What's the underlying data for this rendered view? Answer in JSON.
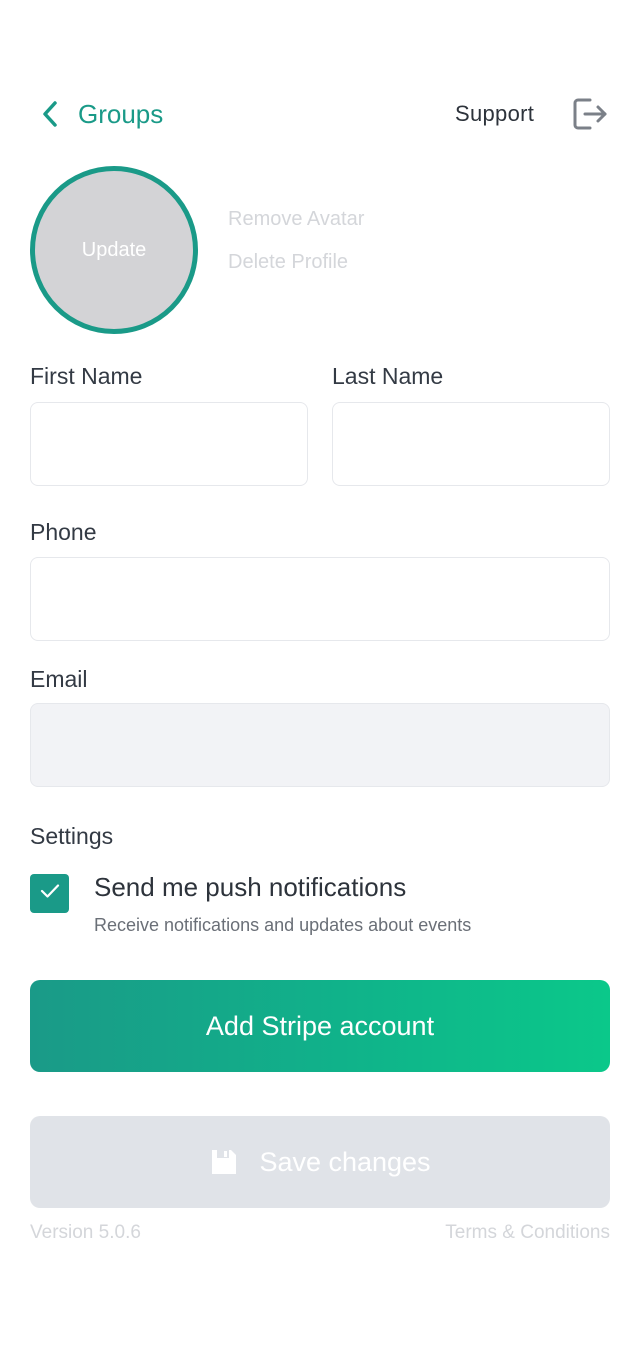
{
  "header": {
    "back_label": "Groups",
    "support_label": "Support"
  },
  "avatar": {
    "update_label": "Update",
    "remove_label": "Remove Avatar",
    "delete_label": "Delete Profile"
  },
  "form": {
    "first_name": {
      "label": "First Name",
      "value": ""
    },
    "last_name": {
      "label": "Last Name",
      "value": ""
    },
    "phone": {
      "label": "Phone",
      "value": ""
    },
    "email": {
      "label": "Email",
      "value": ""
    }
  },
  "settings": {
    "heading": "Settings",
    "push": {
      "title": "Send me push notifications",
      "subtitle": "Receive notifications and updates about events",
      "checked": true
    }
  },
  "buttons": {
    "stripe_label": "Add Stripe account",
    "save_label": "Save changes"
  },
  "footer": {
    "version": "Version 5.0.6",
    "terms": "Terms & Conditions"
  },
  "colors": {
    "accent": "#1a9a88",
    "gradient_end": "#0bc88a",
    "disabled_button": "#e0e3e8"
  },
  "icons": {
    "back": "chevron-left-icon",
    "logout": "logout-icon",
    "check": "check-icon",
    "save": "floppy-disk-icon"
  }
}
